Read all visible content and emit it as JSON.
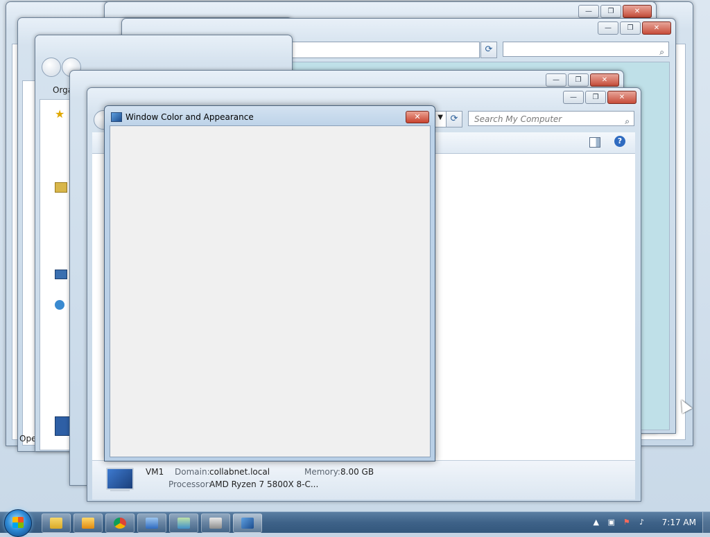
{
  "dialog": {
    "title": "Window Color and Appearance",
    "close_label": "✕"
  },
  "explorer": {
    "search_placeholder": "Search My Computer",
    "left_pane_fragment": "Orga",
    "open_fragment": "Ope"
  },
  "details": {
    "computer_name": "VM1",
    "domain_label": "Domain:",
    "domain_value": "collabnet.local",
    "memory_label": "Memory:",
    "memory_value": "8.00 GB",
    "processor_label": "Processor:",
    "processor_value": "AMD Ryzen 7 5800X 8-C..."
  },
  "window_buttons": {
    "minimize": "—",
    "maximize": "❐",
    "close": "✕"
  },
  "taskbar": {
    "clock": "7:17 AM",
    "items": [
      "explorer",
      "media-player",
      "chrome",
      "explorer-windows",
      "control-panel",
      "server-manager",
      "display-settings"
    ]
  },
  "icons": {
    "search": "search-icon",
    "refresh": "refresh-icon",
    "help": "help-icon",
    "preview_pane": "preview-pane-icon"
  }
}
